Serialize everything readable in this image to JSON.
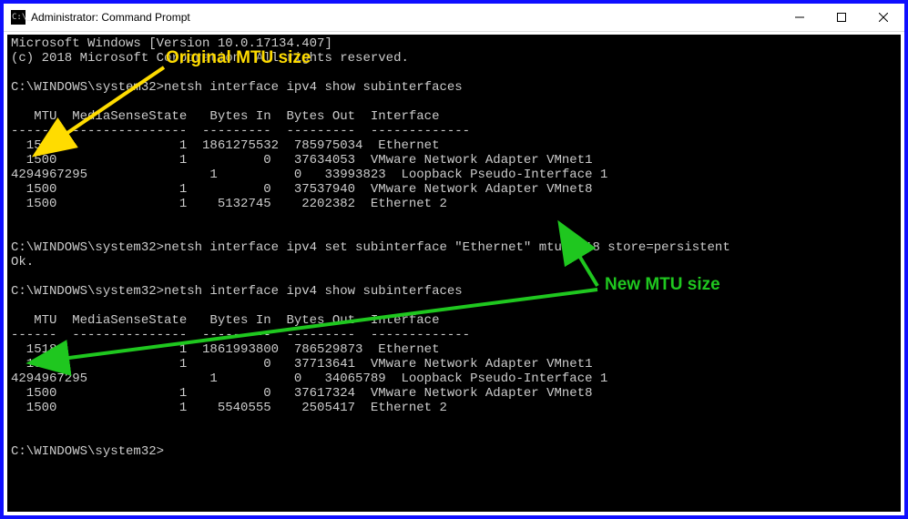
{
  "window": {
    "title": "Administrator: Command Prompt"
  },
  "annotations": {
    "original": "Original MTU size",
    "newmtu": "New MTU size"
  },
  "prompt": "C:\\WINDOWS\\system32>",
  "header_line1": "Microsoft Windows [Version 10.0.17134.407]",
  "header_line2": "(c) 2018 Microsoft Corporation. All rights reserved.",
  "cmd_show": "netsh interface ipv4 show subinterfaces",
  "cmd_set": "netsh interface ipv4 set subinterface \"Ethernet\" mtu=1518 store=persistent",
  "ok": "Ok.",
  "table_header": "   MTU  MediaSenseState   Bytes In  Bytes Out  Interface",
  "table_divider": "------  ---------------  ---------  ---------  -------------",
  "rows1": [
    "  1500                1  1861275532  785975034  Ethernet",
    "  1500                1          0   37634053  VMware Network Adapter VMnet1",
    "4294967295                1          0   33993823  Loopback Pseudo-Interface 1",
    "  1500                1          0   37537940  VMware Network Adapter VMnet8",
    "  1500                1    5132745    2202382  Ethernet 2"
  ],
  "rows2": [
    "  1518                1  1861993800  786529873  Ethernet",
    "  1500                1          0   37713641  VMware Network Adapter VMnet1",
    "4294967295                1          0   34065789  Loopback Pseudo-Interface 1",
    "  1500                1          0   37617324  VMware Network Adapter VMnet8",
    "  1500                1    5540555    2505417  Ethernet 2"
  ],
  "arrows": {
    "yellow": {
      "color": "#ffdc00"
    },
    "green": {
      "color": "#1fc71f"
    }
  }
}
